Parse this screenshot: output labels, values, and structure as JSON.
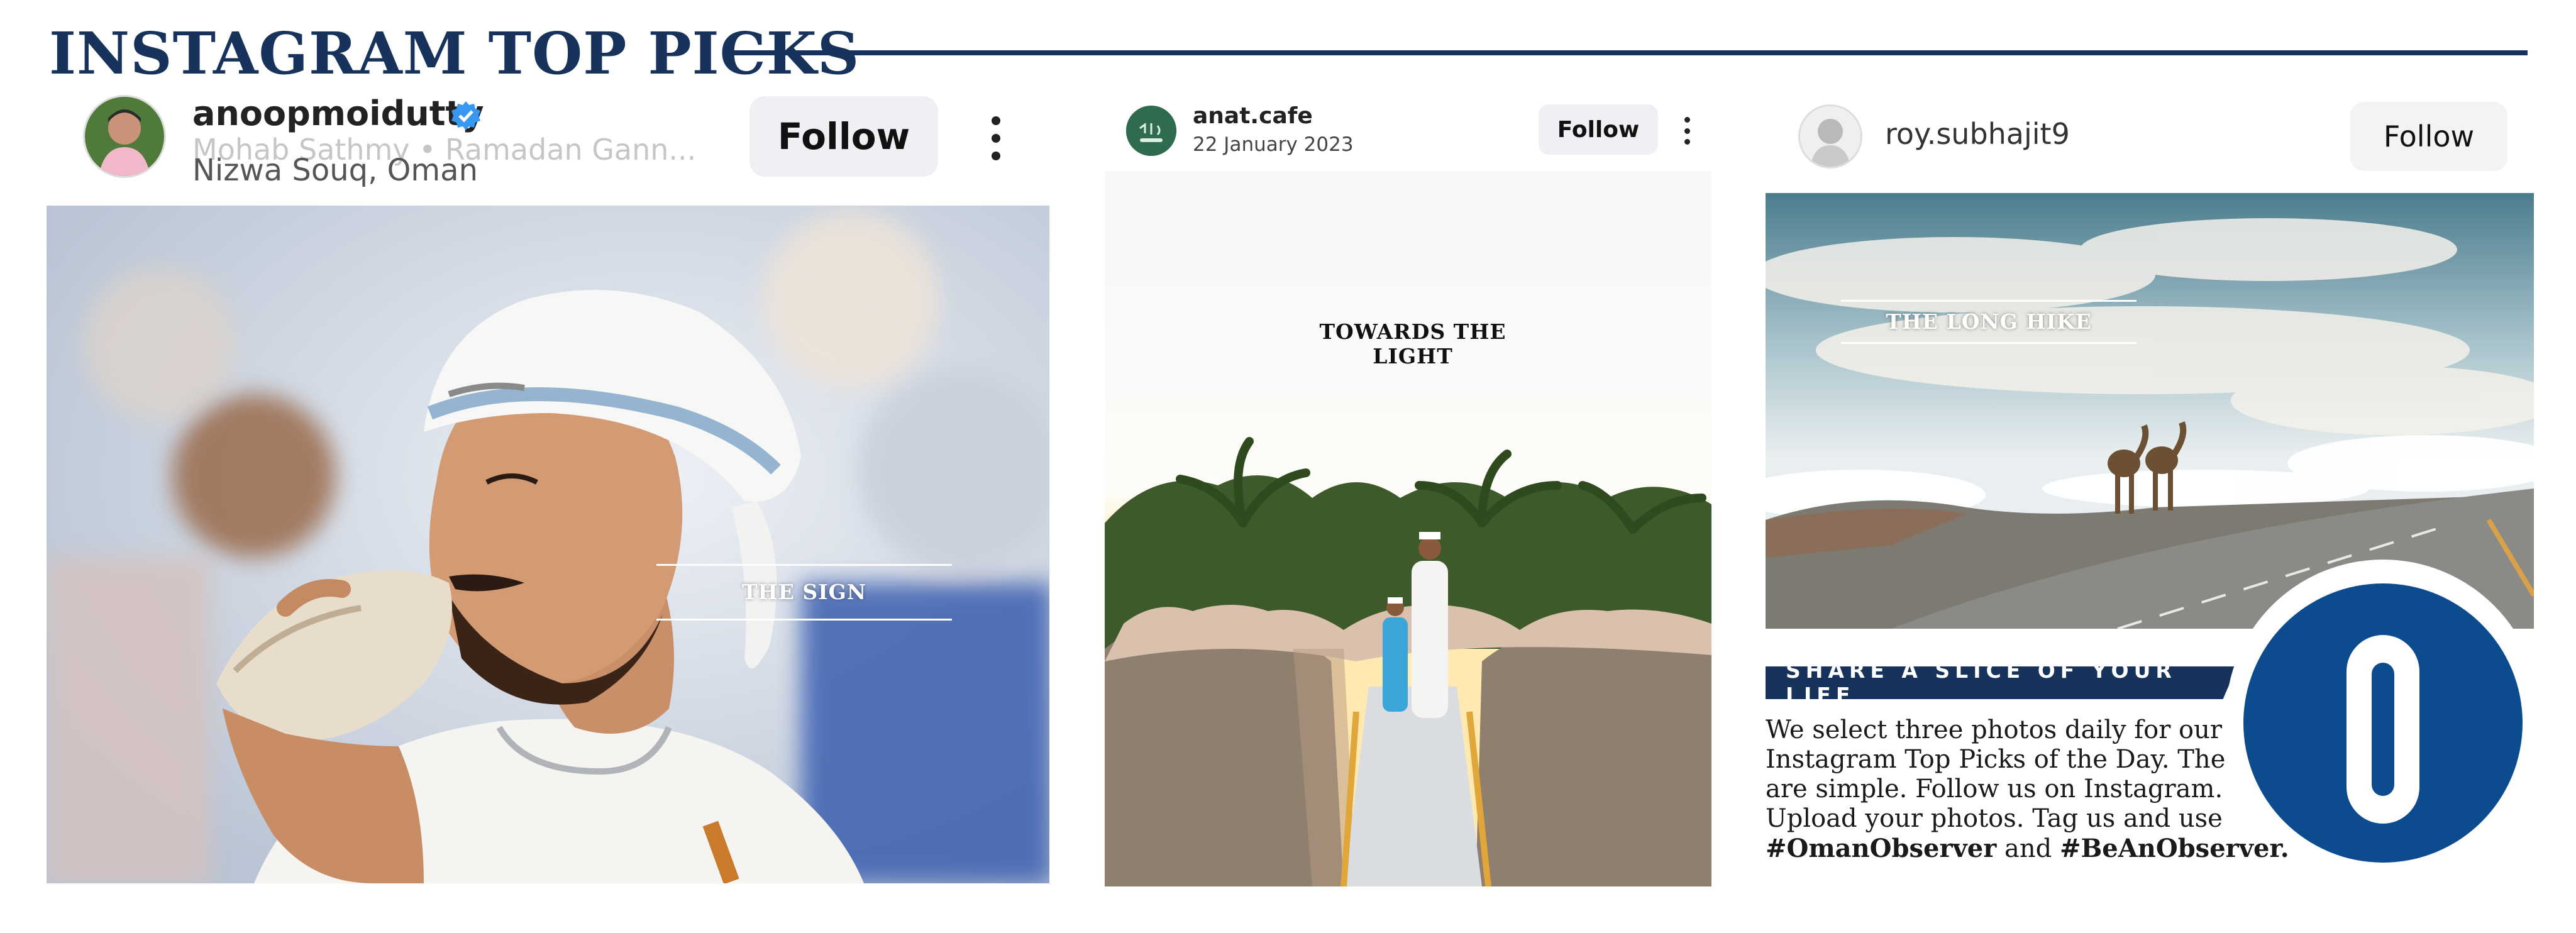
{
  "header": {
    "title": "INSTAGRAM TOP PICKS"
  },
  "posts": [
    {
      "username": "anoopmoidutty",
      "verified": true,
      "audio_line": "Mohab Sathmy • Ramadan Gann...",
      "location": "Nizwa Souq, Oman",
      "follow_label": "Follow",
      "caption": "THE SIGN"
    },
    {
      "username": "anat.cafe",
      "date": "22 January 2023",
      "follow_label": "Follow",
      "caption": "TOWARDS THE LIGHT"
    },
    {
      "username": "roy.subhajit9",
      "follow_label": "Follow",
      "caption": "THE LONG HIKE"
    }
  ],
  "promo": {
    "banner": "SHARE A SLICE OF YOUR LIFE",
    "body": "We select three photos daily for our Instagram Top Picks of the Day. The rules are simple. Follow us on Instagram. Upload your photos. Tag us and use",
    "hashtag1": "#OmanObserver",
    "joiner": "and",
    "hashtag2": "#BeAnObserver."
  },
  "colors": {
    "brand_navy": "#17335c",
    "logo_blue": "#0d4b8f",
    "verified_blue": "#3897f0"
  }
}
